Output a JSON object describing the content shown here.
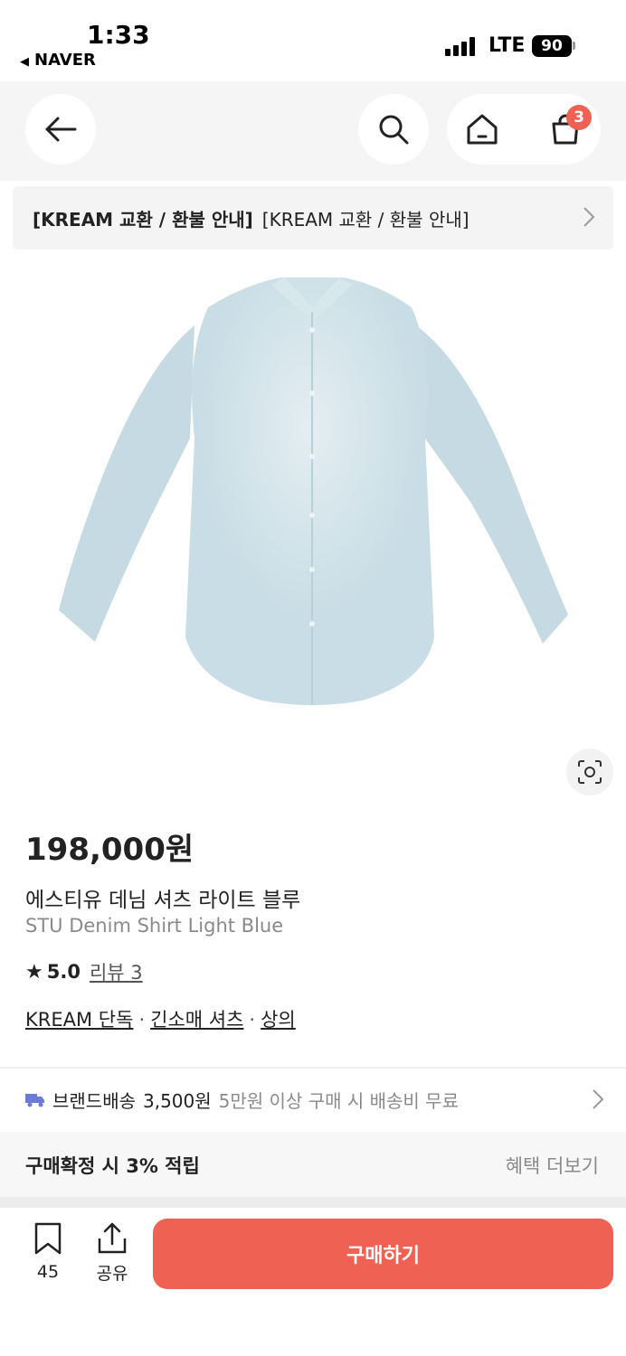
{
  "status_bar": {
    "time": "1:33",
    "back_app": "NAVER",
    "network": "LTE",
    "battery": "90"
  },
  "header": {
    "cart_count": "3"
  },
  "notice": {
    "bold": "[KREAM 교환 / 환불 안내]",
    "text": "[KREAM 교환 / 환불 안내]"
  },
  "product": {
    "price": "198,000원",
    "name_ko": "에스티유 데님 셔츠 라이트 블루",
    "name_en": "STU Denim Shirt Light Blue",
    "rating": "5.0",
    "review": "리뷰 3",
    "tags": [
      "KREAM 단독",
      "긴소매 셔츠",
      "상의"
    ],
    "image_color": "#cfe1e8"
  },
  "delivery": {
    "label": "브랜드배송",
    "fee": "3,500원",
    "free_note": "5만원 이상 구매 시 배송비 무료"
  },
  "benefit": {
    "left": "구매확정 시 3% 적립",
    "right": "혜택 더보기"
  },
  "bottom_bar": {
    "bookmark_count": "45",
    "share_label": "공유",
    "buy_label": "구매하기"
  },
  "colors": {
    "accent": "#ef6253",
    "delivery_icon": "#6b7bd6"
  }
}
